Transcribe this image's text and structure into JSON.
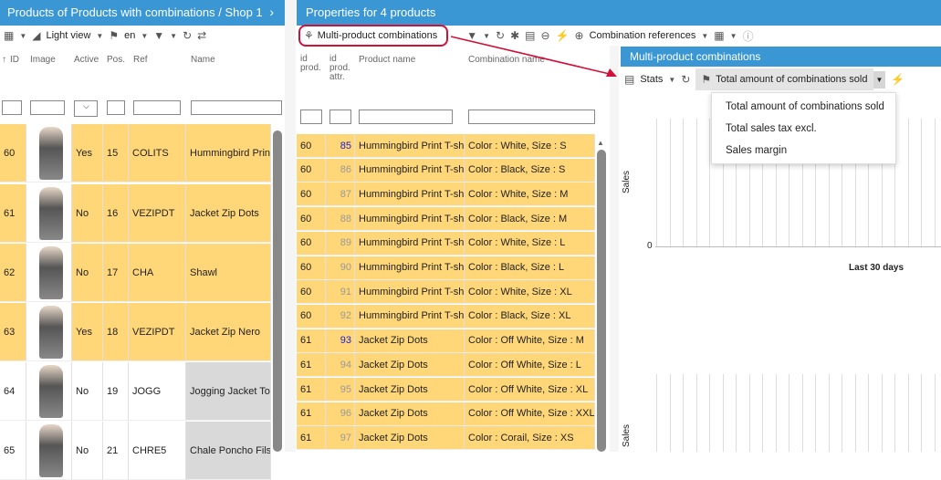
{
  "left": {
    "title": "Products of Products with combinations / Shop 1",
    "toolbar": {
      "light_view": "Light view",
      "lang": "en"
    },
    "headers": [
      "ID",
      "Image",
      "Active",
      "Pos.",
      "Ref",
      "Name"
    ],
    "rows": [
      {
        "id": "60",
        "active": "Yes",
        "pos": "15",
        "ref": "COLITS",
        "name": "Hummingbird Print",
        "sel": true
      },
      {
        "id": "61",
        "active": "No",
        "pos": "16",
        "ref": "VEZIPDT",
        "name": "Jacket Zip Dots",
        "sel": true
      },
      {
        "id": "62",
        "active": "No",
        "pos": "17",
        "ref": "CHA",
        "name": "Shawl",
        "sel": true
      },
      {
        "id": "63",
        "active": "Yes",
        "pos": "18",
        "ref": "VEZIPDT",
        "name": "Jacket Zip Nero",
        "sel": true
      },
      {
        "id": "64",
        "active": "No",
        "pos": "19",
        "ref": "JOGG",
        "name": "Jogging Jacket To",
        "sel": false
      },
      {
        "id": "65",
        "active": "No",
        "pos": "21",
        "ref": "CHRE5",
        "name": "Chale Poncho Fils",
        "sel": false
      }
    ]
  },
  "mid": {
    "title": "Properties for 4 products",
    "toolbar": {
      "multi": "Multi-product combinations",
      "combref": "Combination references"
    },
    "headers": {
      "id_prod": "id\nprod.",
      "id_attr": "id\nprod.\nattr.",
      "name": "Product name",
      "comb": "Combination name"
    },
    "rows": [
      {
        "id": "60",
        "attr": "85",
        "name": "Hummingbird Print T-sh",
        "comb": "Color : White, Size : S",
        "hl": true
      },
      {
        "id": "60",
        "attr": "86",
        "name": "Hummingbird Print T-sh",
        "comb": "Color : Black, Size : S",
        "hl": false
      },
      {
        "id": "60",
        "attr": "87",
        "name": "Hummingbird Print T-sh",
        "comb": "Color : White, Size : M",
        "hl": false
      },
      {
        "id": "60",
        "attr": "88",
        "name": "Hummingbird Print T-sh",
        "comb": "Color : Black, Size : M",
        "hl": false
      },
      {
        "id": "60",
        "attr": "89",
        "name": "Hummingbird Print T-sh",
        "comb": "Color : White, Size : L",
        "hl": false
      },
      {
        "id": "60",
        "attr": "90",
        "name": "Hummingbird Print T-sh",
        "comb": "Color : Black, Size : L",
        "hl": false
      },
      {
        "id": "60",
        "attr": "91",
        "name": "Hummingbird Print T-sh",
        "comb": "Color : White, Size : XL",
        "hl": false
      },
      {
        "id": "60",
        "attr": "92",
        "name": "Hummingbird Print T-sh",
        "comb": "Color : Black, Size : XL",
        "hl": false
      },
      {
        "id": "61",
        "attr": "93",
        "name": "Jacket Zip Dots",
        "comb": "Color : Off White, Size : M",
        "hl": true
      },
      {
        "id": "61",
        "attr": "94",
        "name": "Jacket Zip Dots",
        "comb": "Color : Off White, Size : L",
        "hl": false
      },
      {
        "id": "61",
        "attr": "95",
        "name": "Jacket Zip Dots",
        "comb": "Color : Off White, Size : XL",
        "hl": false
      },
      {
        "id": "61",
        "attr": "96",
        "name": "Jacket Zip Dots",
        "comb": "Color : Off White, Size : XXL",
        "hl": false
      },
      {
        "id": "61",
        "attr": "97",
        "name": "Jacket Zip Dots",
        "comb": "Color : Corail, Size : XS",
        "hl": false
      }
    ]
  },
  "right": {
    "title": "Multi-product combinations",
    "stats": "Stats",
    "selected": "Total amount of combinations sold",
    "menu": [
      "Total amount of combinations sold",
      "Total sales tax excl.",
      "Sales margin"
    ],
    "ylabel": "Sales",
    "zero": "0",
    "xlabel": "Last 30 days"
  },
  "colors": {
    "header": "#3a97d4",
    "selected_row": "#ffd779",
    "accent": "#d0113a"
  }
}
